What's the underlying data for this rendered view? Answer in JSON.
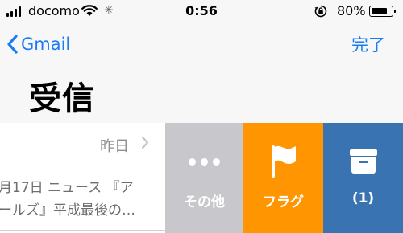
{
  "status_bar": {
    "carrier": "docomo",
    "time": "0:56",
    "battery_percent": "80%",
    "battery_level": 0.8
  },
  "nav": {
    "back_label": "Gmail",
    "done_label": "完了",
    "title": "受信"
  },
  "mail": {
    "date": "昨日",
    "preview": "月17日 ニュース 『ア\nールズ』平成最後の…"
  },
  "swipe_actions": {
    "more_label": "その他",
    "flag_label": "フラグ",
    "archive_label": "(1)"
  },
  "colors": {
    "accent": "#1a7cf5",
    "more": "#c7c7cc",
    "flag": "#ff9500",
    "archive": "#3a73b1"
  },
  "icons": {
    "back": "chevron-left-icon",
    "more": "ellipsis-icon",
    "flag": "flag-icon",
    "archive": "archive-box-icon",
    "mail_chevron": "chevron-right-icon"
  }
}
